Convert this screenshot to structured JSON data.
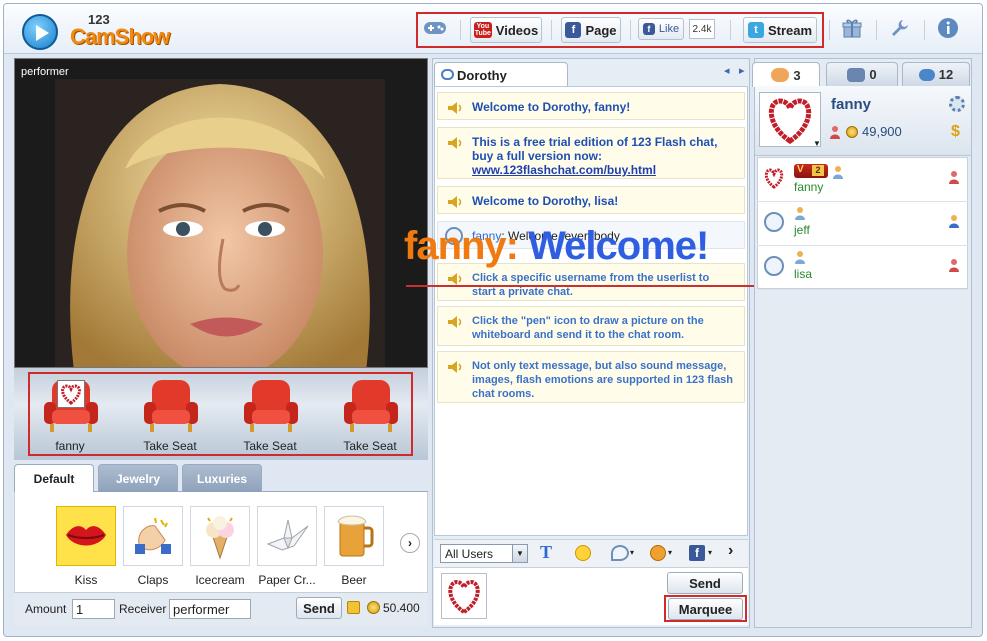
{
  "app": {
    "logo_number": "123",
    "logo_name": "CamShow"
  },
  "header": {
    "videos_label": "Videos",
    "youtube_badge": "You Tube",
    "page_label": "Page",
    "like_label": "Like",
    "like_count": "2.4k",
    "stream_label": "Stream"
  },
  "performer": {
    "label": "performer",
    "seats": [
      {
        "label": "fanny"
      },
      {
        "label": "Take Seat"
      },
      {
        "label": "Take Seat"
      },
      {
        "label": "Take Seat"
      }
    ]
  },
  "gift_tabs": [
    {
      "label": "Default",
      "active": true
    },
    {
      "label": "Jewelry",
      "active": false
    },
    {
      "label": "Luxuries",
      "active": false
    }
  ],
  "gifts": [
    {
      "label": "Kiss",
      "icon": "lips-icon"
    },
    {
      "label": "Claps",
      "icon": "clap-icon"
    },
    {
      "label": "Icecream",
      "icon": "icecream-icon"
    },
    {
      "label": "Paper Cr...",
      "icon": "paper-crane-icon"
    },
    {
      "label": "Beer",
      "icon": "beer-icon"
    }
  ],
  "gift_form": {
    "amount_label": "Amount",
    "amount_value": "1",
    "receiver_label": "Receiver",
    "receiver_value": "performer",
    "send_label": "Send",
    "balance": "50.400"
  },
  "chat": {
    "tab_label": "Dorothy",
    "messages": [
      {
        "text": "Welcome to Dorothy, fanny!"
      },
      {
        "text": "This is a free trial edition of 123 Flash chat, buy a full version now: ",
        "link": "www.123flashchat.com/buy.html"
      },
      {
        "text": "Welcome to Dorothy, lisa!"
      },
      {
        "user": "fanny",
        "text": ": Welcome ,everybody"
      },
      {
        "text": "Click a specific username from the userlist to start a private chat."
      },
      {
        "text": "Click the \"pen\" icon to draw a picture on the whiteboard and send it to the chat room."
      },
      {
        "text": "Not only text message, but also sound message, images, flash emotions are supported in 123 flash chat rooms."
      }
    ],
    "marquee_user": "fanny:",
    "marquee_text": "Welcome!",
    "audience_select": "All Users",
    "send_label": "Send",
    "marquee_label": "Marquee"
  },
  "sidebar": {
    "tabs": [
      {
        "count": "3",
        "icon": "users-icon"
      },
      {
        "count": "0",
        "icon": "group-icon"
      },
      {
        "count": "12",
        "icon": "chat-bubble-icon"
      }
    ],
    "me": {
      "name": "fanny",
      "coins": "49,900"
    },
    "users": [
      {
        "name": "fanny",
        "level": "2"
      },
      {
        "name": "jeff"
      },
      {
        "name": "lisa"
      }
    ]
  },
  "colors": {
    "accent_red": "#d02a2a",
    "link_blue": "#1e4fb2",
    "marquee_orange": "#f07a10",
    "marquee_blue": "#2f5fe0"
  }
}
